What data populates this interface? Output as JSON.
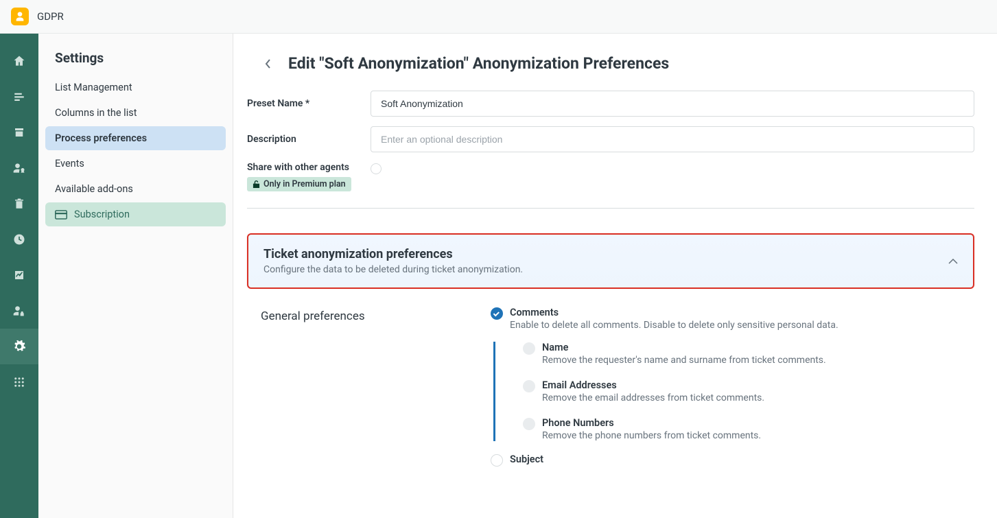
{
  "app": {
    "title": "GDPR"
  },
  "sidebar": {
    "title": "Settings",
    "items": [
      {
        "label": "List Management"
      },
      {
        "label": "Columns in the list"
      },
      {
        "label": "Process preferences"
      },
      {
        "label": "Events"
      },
      {
        "label": "Available add-ons"
      },
      {
        "label": "Subscription"
      }
    ]
  },
  "page": {
    "title": "Edit \"Soft Anonymization\" Anonymization Preferences"
  },
  "form": {
    "preset_name_label": "Preset Name *",
    "preset_name_value": "Soft Anonymization",
    "description_label": "Description",
    "description_placeholder": "Enter an optional description",
    "share_label": "Share with other agents",
    "premium_badge": "Only in Premium plan"
  },
  "section": {
    "title": "Ticket anonymization preferences",
    "subtitle": "Configure the data to be deleted during ticket anonymization."
  },
  "prefs": {
    "group_title": "General preferences",
    "comments": {
      "label": "Comments",
      "desc": "Enable to delete all comments. Disable to delete only sensitive personal data."
    },
    "name": {
      "label": "Name",
      "desc": "Remove the requester's name and surname from ticket comments."
    },
    "email": {
      "label": "Email Addresses",
      "desc": "Remove the email addresses from ticket comments."
    },
    "phone": {
      "label": "Phone Numbers",
      "desc": "Remove the phone numbers from ticket comments."
    },
    "subject": {
      "label": "Subject"
    }
  }
}
